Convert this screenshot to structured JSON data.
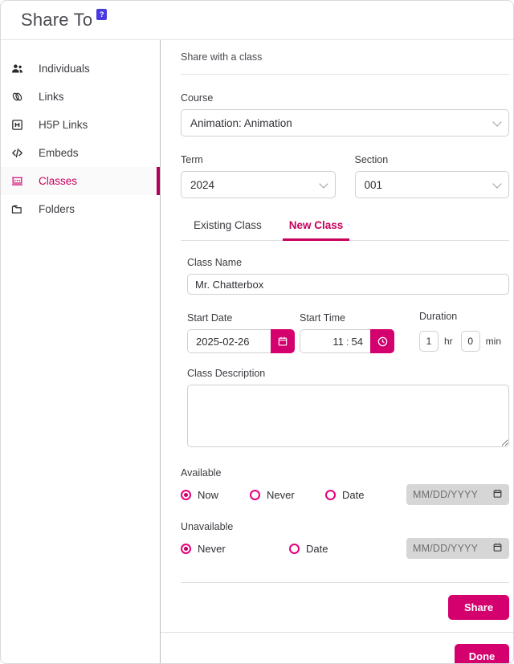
{
  "header": {
    "title": "Share To",
    "help_badge": "?"
  },
  "sidebar": {
    "items": [
      {
        "label": "Individuals",
        "icon": "people-icon",
        "active": false
      },
      {
        "label": "Links",
        "icon": "link-icon",
        "active": false
      },
      {
        "label": "H5P Links",
        "icon": "h5p-icon",
        "active": false
      },
      {
        "label": "Embeds",
        "icon": "code-icon",
        "active": false
      },
      {
        "label": "Classes",
        "icon": "classroom-icon",
        "active": true
      },
      {
        "label": "Folders",
        "icon": "folder-icon",
        "active": false
      }
    ]
  },
  "main": {
    "section_heading": "Share with a class",
    "course": {
      "label": "Course",
      "value": "Animation: Animation"
    },
    "term": {
      "label": "Term",
      "value": "2024"
    },
    "section": {
      "label": "Section",
      "value": "001"
    },
    "tabs": [
      {
        "label": "Existing Class",
        "active": false
      },
      {
        "label": "New Class",
        "active": true
      }
    ],
    "class_name": {
      "label": "Class Name",
      "value": "Mr. Chatterbox"
    },
    "start_date": {
      "label": "Start Date",
      "value": "2025-02-26"
    },
    "start_time": {
      "label": "Start Time",
      "hours": "11",
      "separator": ":",
      "minutes": "54"
    },
    "duration": {
      "label": "Duration",
      "hours": "1",
      "hours_unit": "hr",
      "minutes": "0",
      "minutes_unit": "min"
    },
    "class_description": {
      "label": "Class Description",
      "value": ""
    },
    "available": {
      "label": "Available",
      "options": [
        {
          "label": "Now",
          "selected": true
        },
        {
          "label": "Never",
          "selected": false
        },
        {
          "label": "Date",
          "selected": false
        }
      ],
      "date_placeholder": "MM/DD/YYYY"
    },
    "unavailable": {
      "label": "Unavailable",
      "options": [
        {
          "label": "Never",
          "selected": true
        },
        {
          "label": "Date",
          "selected": false
        }
      ],
      "date_placeholder": "MM/DD/YYYY"
    },
    "share_button": "Share",
    "done_button": "Done"
  },
  "colors": {
    "accent": "#d4006e",
    "accent_dark": "#c8005c",
    "badge": "#4b3ae0"
  }
}
